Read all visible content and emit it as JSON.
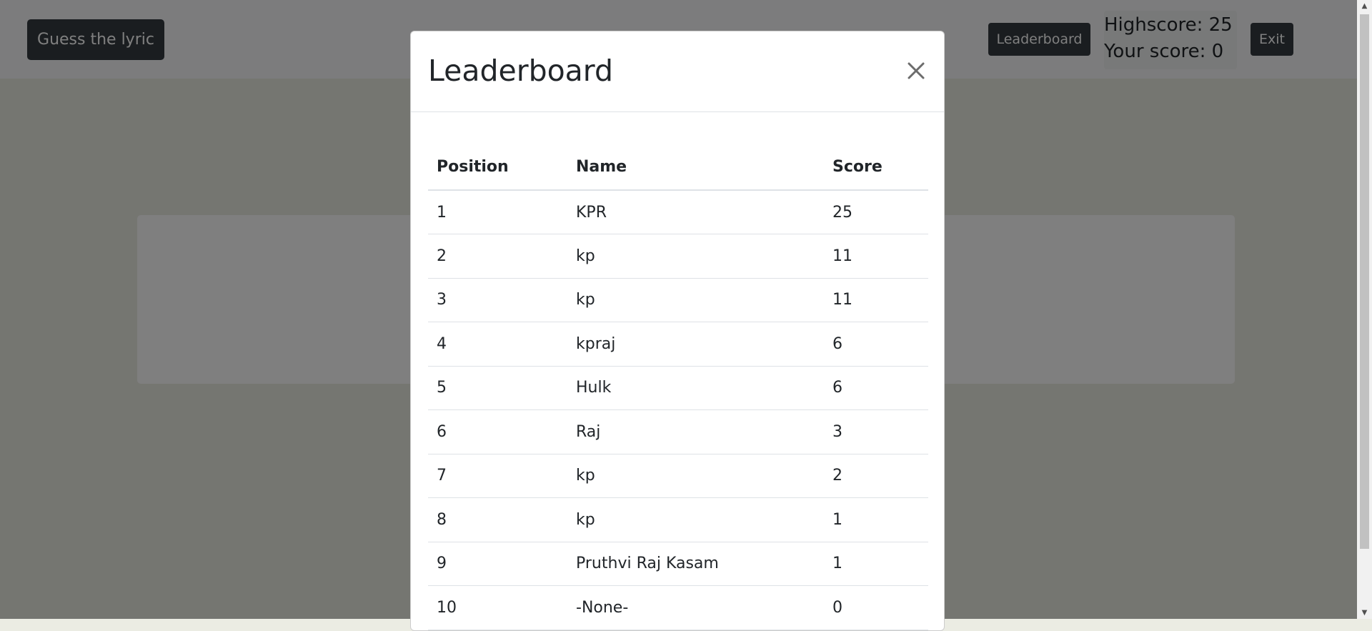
{
  "navbar": {
    "brand_label": "Guess the lyric",
    "leaderboard_label": "Leaderboard",
    "highscore_text": "Highscore: 25",
    "your_score_text": "Your score: 0",
    "exit_label": "Exit"
  },
  "modal": {
    "title": "Leaderboard",
    "close_icon": "close-icon",
    "table": {
      "headers": [
        "Position",
        "Name",
        "Score"
      ],
      "rows": [
        {
          "position": "1",
          "name": "KPR",
          "score": "25"
        },
        {
          "position": "2",
          "name": "kp",
          "score": "11"
        },
        {
          "position": "3",
          "name": "kp",
          "score": "11"
        },
        {
          "position": "4",
          "name": "kpraj",
          "score": "6"
        },
        {
          "position": "5",
          "name": "Hulk",
          "score": "6"
        },
        {
          "position": "6",
          "name": "Raj",
          "score": "3"
        },
        {
          "position": "7",
          "name": "kp",
          "score": "2"
        },
        {
          "position": "8",
          "name": "kp",
          "score": "1"
        },
        {
          "position": "9",
          "name": "Pruthvi Raj Kasam",
          "score": "1"
        },
        {
          "position": "10",
          "name": "-None-",
          "score": "0"
        }
      ]
    }
  },
  "colors": {
    "navbar_button": "#343a40",
    "backdrop": "rgba(0,0,0,0.5)",
    "page_background": "#ebece3"
  }
}
